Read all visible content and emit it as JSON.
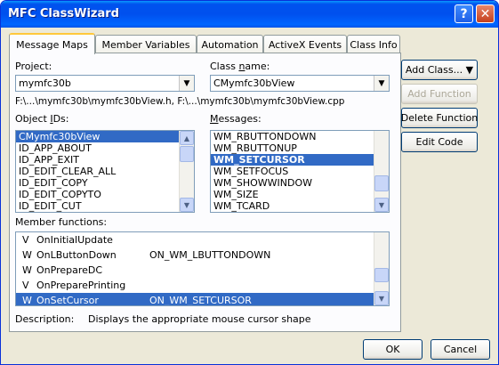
{
  "window": {
    "title": "MFC ClassWizard",
    "help_glyph": "?",
    "close_glyph": "✕"
  },
  "tabs": [
    {
      "label": "Message Maps"
    },
    {
      "label": "Member Variables"
    },
    {
      "label": "Automation"
    },
    {
      "label": "ActiveX Events"
    },
    {
      "label": "Class Info"
    }
  ],
  "project": {
    "label": "Project:",
    "value": "mymfc30b"
  },
  "class_name": {
    "label_pre": "Class ",
    "label_u": "n",
    "label_post": "ame:",
    "value": "CMymfc30bView"
  },
  "files_path": "F:\\...\\mymfc30b\\mymfc30bView.h, F:\\...\\mymfc30b\\mymfc30bView.cpp",
  "object_ids": {
    "label_pre": "Object ",
    "label_u": "I",
    "label_post": "Ds:",
    "items": [
      "CMymfc30bView",
      "ID_APP_ABOUT",
      "ID_APP_EXIT",
      "ID_EDIT_CLEAR_ALL",
      "ID_EDIT_COPY",
      "ID_EDIT_COPYTO",
      "ID_EDIT_CUT"
    ]
  },
  "messages": {
    "label_pre": "",
    "label_u": "M",
    "label_post": "essages:",
    "items": [
      "WM_RBUTTONDOWN",
      "WM_RBUTTONUP",
      "WM_SETCURSOR",
      "WM_SETFOCUS",
      "WM_SHOWWINDOW",
      "WM_SIZE",
      "WM_TCARD"
    ]
  },
  "member_functions": {
    "label": "Member functions:",
    "rows": [
      {
        "flag": "V",
        "name": "OnInitialUpdate",
        "msg": ""
      },
      {
        "flag": "W",
        "name": "OnLButtonDown",
        "msg": "ON_WM_LBUTTONDOWN"
      },
      {
        "flag": "W",
        "name": "OnPrepareDC",
        "msg": ""
      },
      {
        "flag": "V",
        "name": "OnPreparePrinting",
        "msg": ""
      },
      {
        "flag": "W",
        "name": "OnSetCursor",
        "msg": "ON_WM_SETCURSOR"
      }
    ]
  },
  "description": {
    "label": "Description:",
    "text": "Displays the appropriate mouse cursor shape"
  },
  "buttons": {
    "add_class": "Add Class... ▼",
    "add_function": "Add Function",
    "delete_function": "Delete Function",
    "edit_code": "Edit Code",
    "ok": "OK",
    "cancel": "Cancel"
  }
}
